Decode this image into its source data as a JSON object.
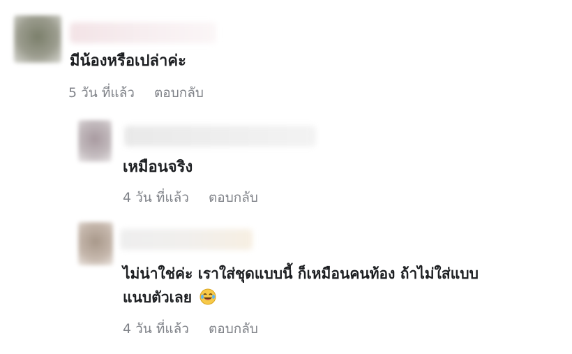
{
  "comments": [
    {
      "text": "มีน้องหรือเปล่าค่ะ",
      "time": "5 วัน ที่แล้ว",
      "reply": "ตอบกลับ",
      "avatar_color": "#8d8f7f"
    },
    {
      "text": "เหมือนจริง",
      "time": "4 วัน ที่แล้ว",
      "reply": "ตอบกลับ",
      "avatar_color": "#b3a9ac"
    },
    {
      "text_line1": "ไม่น่าใช่ค่ะ เราใส่ชุดแบบนี้ ก็เหมือนคนท้อง ถ้าไม่ใส่แบบ",
      "text_line2": "แนบตัวเลย",
      "emoji": "laughing-crying-emoji-icon",
      "time": "4 วัน ที่แล้ว",
      "reply": "ตอบกลับ",
      "avatar_color": "#b5a79b"
    }
  ]
}
